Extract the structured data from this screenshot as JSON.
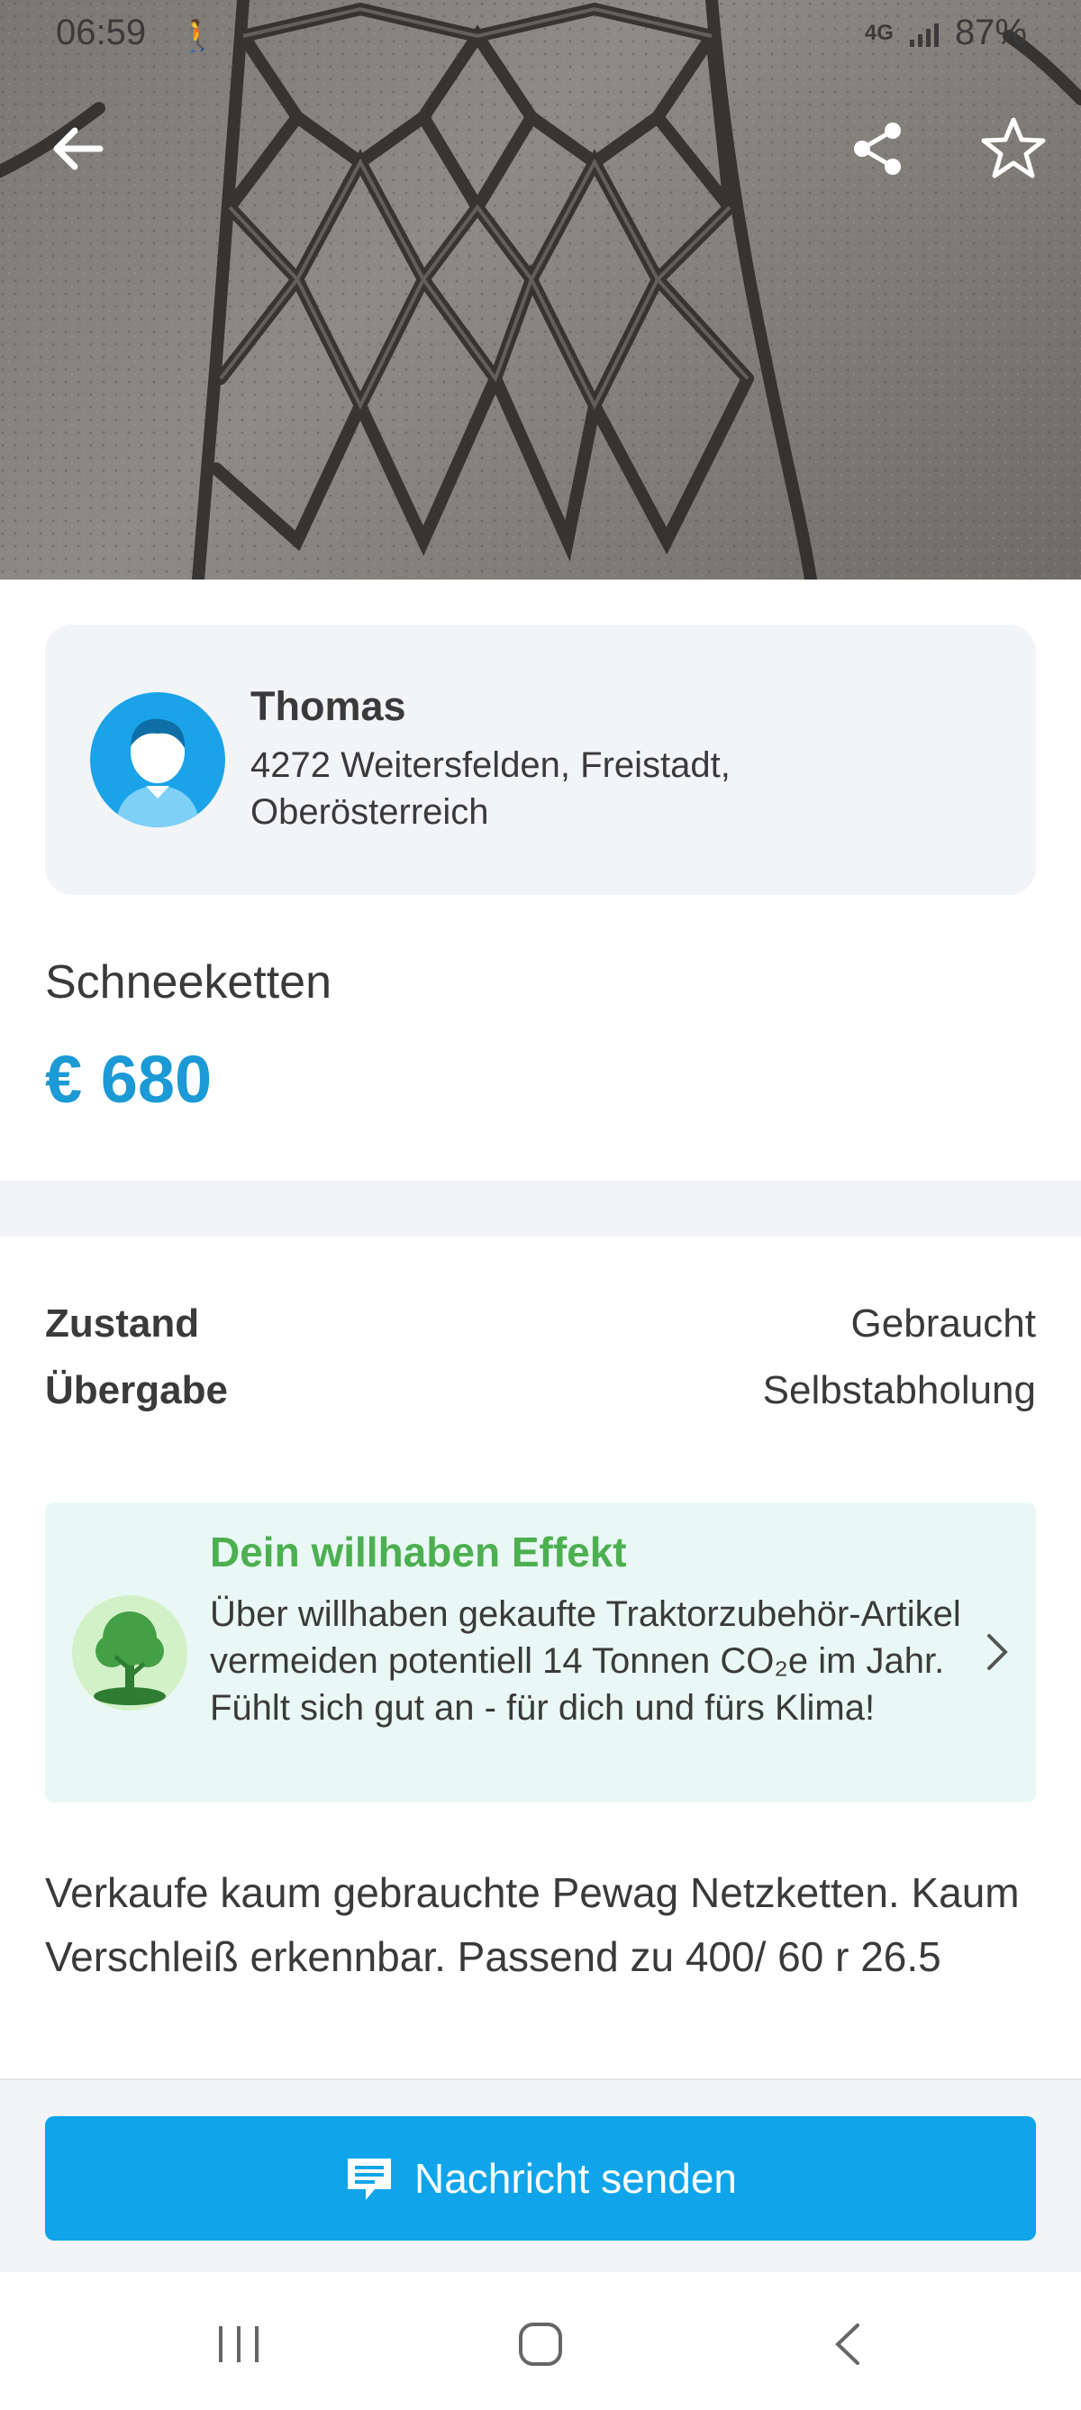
{
  "status_bar": {
    "time": "06:59",
    "network": "4G",
    "battery": "87%"
  },
  "hero": {
    "back_icon": "arrow-left-icon",
    "share_icon": "share-icon",
    "favorite_icon": "star-outline-icon"
  },
  "seller": {
    "name": "Thomas",
    "location": "4272 Weitersfelden, Freistadt, Oberösterreich",
    "avatar_icon": "user-avatar-icon"
  },
  "listing": {
    "title": "Schneeketten",
    "price": "€ 680"
  },
  "attributes": [
    {
      "label": "Zustand",
      "value": "Gebraucht"
    },
    {
      "label": "Übergabe",
      "value": "Selbstabholung"
    }
  ],
  "effect": {
    "title": "Dein willhaben Effekt",
    "text": "Über willhaben gekaufte Traktorzubehör-Artikel vermeiden potentiell 14 Tonnen CO₂e im Jahr. Fühlt sich gut an - für dich und fürs Klima!"
  },
  "description": "Verkaufe kaum gebrauchte Pewag Netzketten. Kaum Verschleiß erkennbar. Passend zu 400/ 60 r 26.5",
  "actions": {
    "send_message": "Nachricht senden"
  },
  "colors": {
    "accent": "#10a5ea",
    "price": "#1b9ad6",
    "effect_green": "#4caf50",
    "panel_bg": "#f2f4f8"
  }
}
